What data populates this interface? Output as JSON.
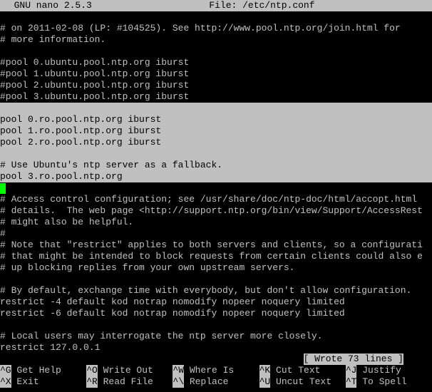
{
  "titlebar": {
    "app": "  GNU nano 2.5.3",
    "file": "File: /etc/ntp.conf"
  },
  "lines": {
    "l0": "# on 2011-02-08 (LP: #104525). See http://www.pool.ntp.org/join.html for",
    "l1": "# more information.",
    "l2": "#pool 0.ubuntu.pool.ntp.org iburst",
    "l3": "#pool 1.ubuntu.pool.ntp.org iburst",
    "l4": "#pool 2.ubuntu.pool.ntp.org iburst",
    "l5": "#pool 3.ubuntu.pool.ntp.org iburst",
    "l6": "pool 0.ro.pool.ntp.org iburst",
    "l7": "pool 1.ro.pool.ntp.org iburst",
    "l8": "pool 2.ro.pool.ntp.org iburst",
    "l9": "# Use Ubuntu's ntp server as a fallback.",
    "l10": "pool 3.ro.pool.ntp.org",
    "l11": "# Access control configuration; see /usr/share/doc/ntp-doc/html/accopt.html",
    "l12": "# details.  The web page <http://support.ntp.org/bin/view/Support/AccessRest",
    "l13": "# might also be helpful.",
    "l14": "#",
    "l15": "# Note that \"restrict\" applies to both servers and clients, so a configurati",
    "l16": "# that might be intended to block requests from certain clients could also e",
    "l17": "# up blocking replies from your own upstream servers.",
    "l18": "# By default, exchange time with everybody, but don't allow configuration.",
    "l19": "restrict -4 default kod notrap nomodify nopeer noquery limited",
    "l20": "restrict -6 default kod notrap nomodify nopeer noquery limited",
    "l21": "# Local users may interrogate the ntp server more closely.",
    "l22": "restrict 127.0.0.1"
  },
  "status": "[ Wrote 73 lines ]",
  "shortcuts": {
    "row1": [
      {
        "key": "^G",
        "label": " Get Help"
      },
      {
        "key": "^O",
        "label": " Write Out"
      },
      {
        "key": "^W",
        "label": " Where Is"
      },
      {
        "key": "^K",
        "label": " Cut Text"
      },
      {
        "key": "^J",
        "label": " Justify"
      }
    ],
    "row2": [
      {
        "key": "^X",
        "label": " Exit"
      },
      {
        "key": "^R",
        "label": " Read File"
      },
      {
        "key": "^\\",
        "label": " Replace"
      },
      {
        "key": "^U",
        "label": " Uncut Text"
      },
      {
        "key": "^T",
        "label": " To Spell"
      }
    ]
  }
}
